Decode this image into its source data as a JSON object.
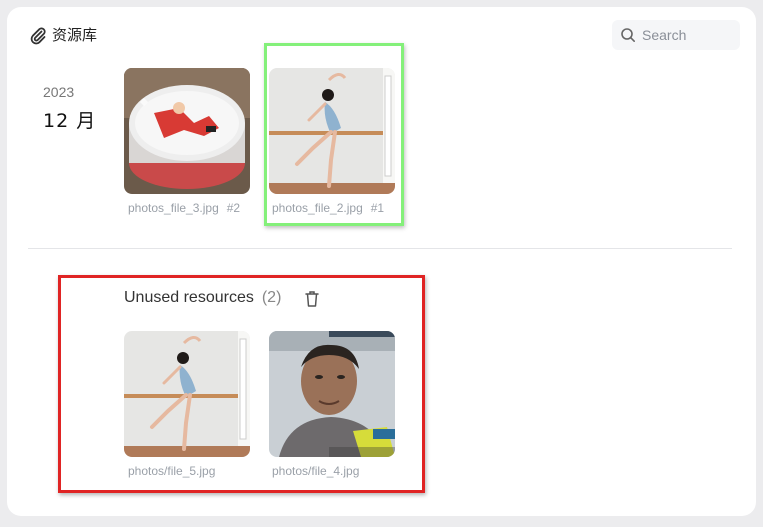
{
  "header": {
    "title": "资源库",
    "icon": "paperclip-icon"
  },
  "search": {
    "placeholder": "Search",
    "icon": "search-icon"
  },
  "timeline": {
    "year": "2023",
    "month": "12 月",
    "items": [
      {
        "name": "photos_file_3.jpg",
        "ref": "#2"
      },
      {
        "name": "photos_file_2.jpg",
        "ref": "#1"
      }
    ]
  },
  "unused": {
    "title": "Unused resources",
    "count": "(2)",
    "items": [
      {
        "name": "photos/file_5.jpg"
      },
      {
        "name": "photos/file_4.jpg"
      }
    ]
  },
  "colors": {
    "highlight_green": "#84f07a",
    "highlight_red": "#e02424"
  }
}
